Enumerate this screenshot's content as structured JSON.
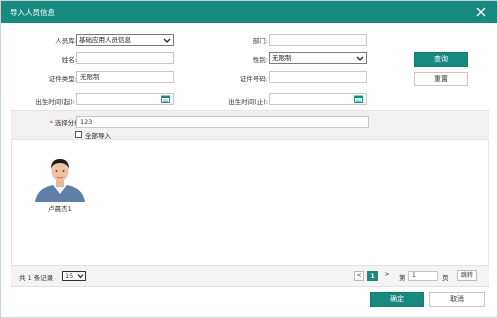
{
  "dialog": {
    "title": "导入人员信息"
  },
  "form": {
    "library_label": "人员库:",
    "library_value": "基础应用人员信息",
    "department_label": "部门:",
    "department_value": "",
    "name_label": "姓名:",
    "name_value": "",
    "gender_label": "性别:",
    "gender_value": "无限制",
    "idtype_label": "证件类型:",
    "idtype_value": "无限制",
    "idnum_label": "证件号码:",
    "idnum_value": "",
    "birth_start_label": "出生时间(起):",
    "birth_start_value": "",
    "birth_end_label": "出生时间(止):",
    "birth_end_value": ""
  },
  "actions": {
    "search": "查询",
    "reset": "重置"
  },
  "group": {
    "star": "*",
    "label": "选择分组:",
    "value": "123",
    "import_all_label": "全部导入",
    "import_all_checked": false
  },
  "people": [
    {
      "name": "卢晨杰1"
    }
  ],
  "pager": {
    "total_text": "共 1 条记录",
    "page_size": "15",
    "prev": "<",
    "current": "1",
    "next": ">",
    "goto_prefix": "第",
    "goto_value": "1",
    "goto_suffix": "页",
    "goto_button": "跳转"
  },
  "footer": {
    "ok": "确定",
    "cancel": "取消"
  },
  "colors": {
    "accent": "#178a80"
  }
}
